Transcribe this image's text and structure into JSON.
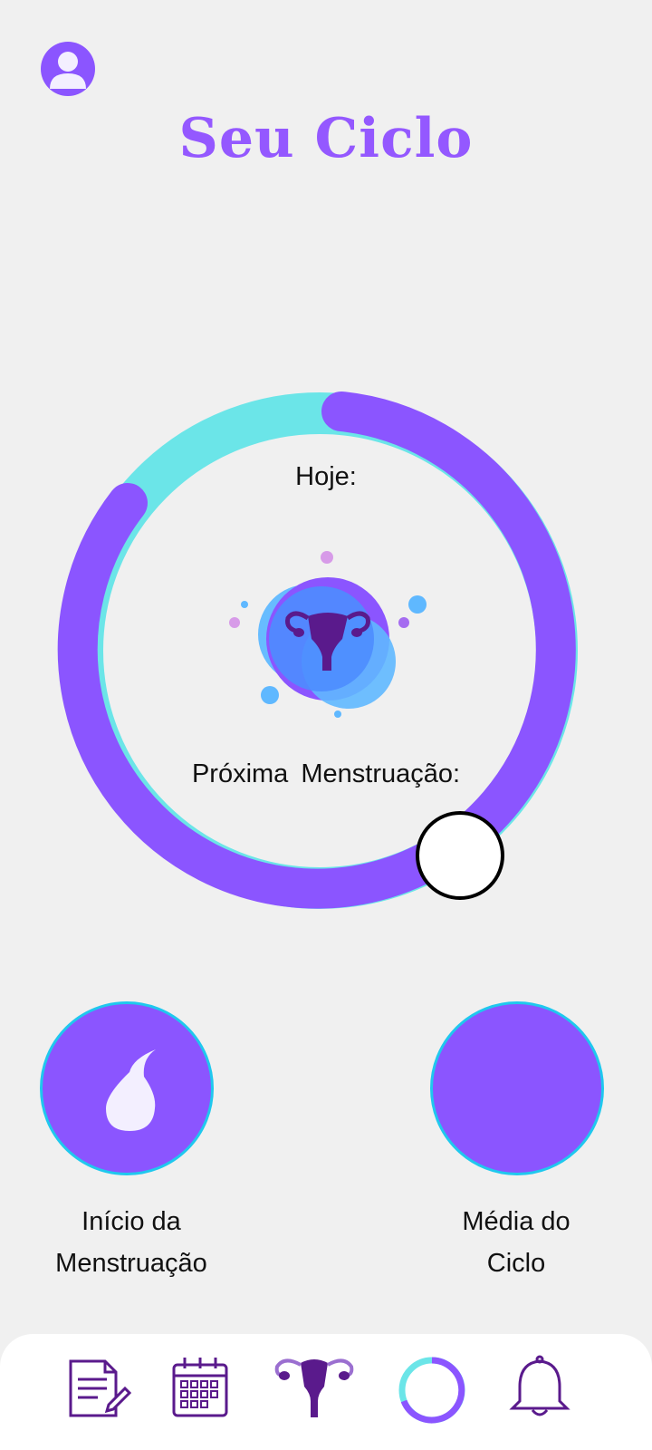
{
  "header": {
    "title": "Seu Ciclo",
    "profile_icon": "user-avatar-icon"
  },
  "cycle": {
    "today_label": "Hoje:",
    "next_period_label": "Próxima  Menstruação:",
    "center_icon": "uterus-icon",
    "colors": {
      "track": "#6be5e8",
      "progress": "#8b55ff",
      "marker": "#ffffff"
    }
  },
  "actions": {
    "period_start": {
      "label_line1": "Início da",
      "label_line2": "Menstruação",
      "icon": "drop-icon"
    },
    "cycle_average": {
      "label_line1": "Média do",
      "label_line2": "Ciclo"
    }
  },
  "nav": {
    "items": [
      {
        "icon": "notes-icon"
      },
      {
        "icon": "calendar-icon"
      },
      {
        "icon": "uterus-icon"
      },
      {
        "icon": "cycle-ring-icon"
      },
      {
        "icon": "bell-icon"
      }
    ]
  },
  "colors": {
    "background": "#f0f0f0",
    "accent": "#8b55ff",
    "accent_light": "#6be5e8",
    "nav_icon": "#5a1a8c"
  }
}
